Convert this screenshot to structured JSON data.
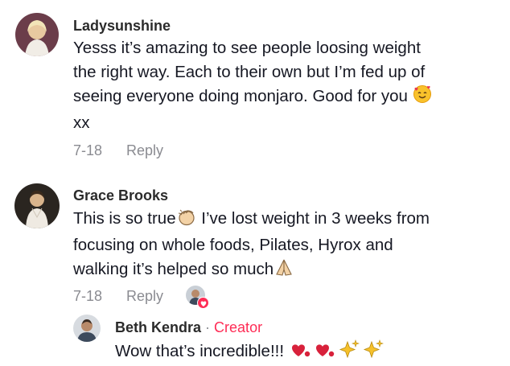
{
  "comments": [
    {
      "author": "Ladysunshine",
      "text_line1": "Yesss it’s amazing to see people loosing weight",
      "text_line2": "the right way. Each to their own but I’m fed up of",
      "text_line3": "seeing everyone doing monjaro. Good for you",
      "text_line4": "xx",
      "date": "7-18",
      "reply_label": "Reply",
      "trailing_emoji": "smiling-face-with-hearts-icon"
    },
    {
      "author": "Grace Brooks",
      "text_line1a": "This is so true",
      "text_line1b": " I’ve lost weight in 3 weeks from",
      "text_line2": "focusing on whole foods, Pilates, Hyrox and",
      "text_line3": "walking it’s helped so much",
      "date": "7-18",
      "reply_label": "Reply",
      "emojis": [
        "clapping-hands-icon",
        "folded-hands-icon"
      ]
    }
  ],
  "reply": {
    "author": "Beth Kendra",
    "separator": "·",
    "badge": "Creator",
    "text": "Wow that’s incredible!!!",
    "emojis": [
      "heart-exclamation-icon",
      "heart-exclamation-icon",
      "sparkles-icon",
      "sparkles-icon"
    ]
  },
  "colors": {
    "accent": "#fe2c55",
    "muted": "#8a8b91",
    "text": "#161823",
    "heart_like": "#fe2c55"
  }
}
